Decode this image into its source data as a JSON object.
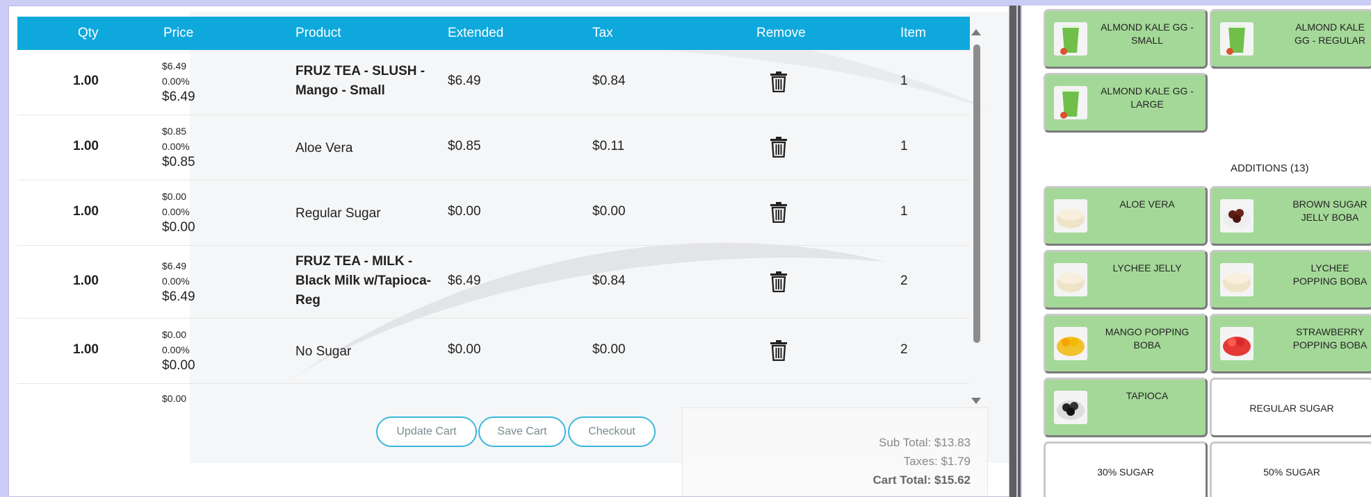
{
  "table": {
    "headers": {
      "qty": "Qty",
      "price": "Price",
      "product": "Product",
      "extended": "Extended",
      "tax": "Tax",
      "remove": "Remove",
      "item": "Item"
    },
    "rows": [
      {
        "qty": "1.00",
        "price": "$6.49",
        "disc": "0.00%",
        "net": "$6.49",
        "product": "FRUZ TEA - SLUSH - Mango - Small",
        "extended": "$6.49",
        "tax": "$0.84",
        "item": "1"
      },
      {
        "qty": "1.00",
        "price": "$0.85",
        "disc": "0.00%",
        "net": "$0.85",
        "product": "Aloe Vera",
        "extended": "$0.85",
        "tax": "$0.11",
        "item": "1"
      },
      {
        "qty": "1.00",
        "price": "$0.00",
        "disc": "0.00%",
        "net": "$0.00",
        "product": "Regular Sugar",
        "extended": "$0.00",
        "tax": "$0.00",
        "item": "1"
      },
      {
        "qty": "1.00",
        "price": "$6.49",
        "disc": "0.00%",
        "net": "$6.49",
        "product": "FRUZ TEA - MILK - Black Milk w/Tapioca- Reg",
        "extended": "$6.49",
        "tax": "$0.84",
        "item": "2"
      },
      {
        "qty": "1.00",
        "price": "$0.00",
        "disc": "0.00%",
        "net": "$0.00",
        "product": "No Sugar",
        "extended": "$0.00",
        "tax": "$0.00",
        "item": "2"
      },
      {
        "price": "$0.00"
      }
    ]
  },
  "buttons": {
    "update": "Update Cart",
    "save": "Save Cart",
    "checkout": "Checkout"
  },
  "totals": {
    "subtotal": "Sub Total: $13.83",
    "taxes": "Taxes: $1.79",
    "cart_total": "Cart Total: $15.62"
  },
  "menu": {
    "drinks": [
      "ALMOND KALE GG - SMALL",
      "ALMOND KALE GG - REGULAR",
      "ALMOND KALE GG - LARGE"
    ],
    "additions_title": "ADDITIONS (13)",
    "additions": [
      "ALOE VERA",
      "BROWN SUGAR JELLY BOBA",
      "LYCHEE JELLY",
      "LYCHEE POPPING BOBA",
      "MANGO POPPING BOBA",
      "STRAWBERRY POPPING BOBA",
      "TAPIOCA",
      "REGULAR SUGAR",
      "30% SUGAR",
      "50% SUGAR"
    ]
  },
  "colors": {
    "header_blue": "#0fa8dc",
    "tile_green": "#a4d898",
    "button_outline": "#38b6de"
  }
}
